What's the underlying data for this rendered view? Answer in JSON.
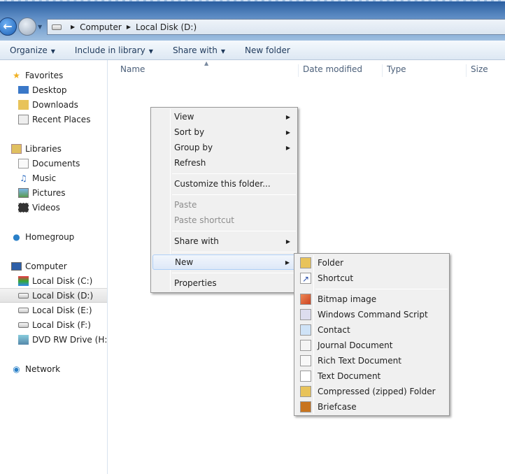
{
  "address": {
    "crumbs": [
      "Computer",
      "Local Disk (D:)"
    ]
  },
  "toolbar": {
    "organize": "Organize",
    "include": "Include in library",
    "share": "Share with",
    "new_folder": "New folder"
  },
  "sidebar": {
    "favorites": "Favorites",
    "fav_items": [
      "Desktop",
      "Downloads",
      "Recent Places"
    ],
    "libraries": "Libraries",
    "lib_items": [
      "Documents",
      "Music",
      "Pictures",
      "Videos"
    ],
    "homegroup": "Homegroup",
    "computer": "Computer",
    "comp_items": [
      "Local Disk (C:)",
      "Local Disk (D:)",
      "Local Disk (E:)",
      "Local Disk (F:)",
      "DVD RW Drive (H:) G"
    ],
    "network": "Network",
    "selected": "Local Disk (D:)"
  },
  "columns": [
    "Name",
    "Date modified",
    "Type",
    "Size"
  ],
  "context_menu": {
    "items": [
      {
        "label": "View",
        "submenu": true
      },
      {
        "label": "Sort by",
        "submenu": true
      },
      {
        "label": "Group by",
        "submenu": true
      },
      {
        "label": "Refresh"
      },
      {
        "label": "Customize this folder..."
      },
      {
        "label": "Paste",
        "disabled": true
      },
      {
        "label": "Paste shortcut",
        "disabled": true
      },
      {
        "label": "Share with",
        "submenu": true
      },
      {
        "label": "New",
        "submenu": true,
        "highlighted": true
      },
      {
        "label": "Properties"
      }
    ]
  },
  "new_submenu": {
    "items": [
      {
        "label": "Folder",
        "icon": "folder-icon"
      },
      {
        "label": "Shortcut",
        "icon": "shortcut-icon"
      },
      {
        "label": "Bitmap image",
        "icon": "bitmap-icon"
      },
      {
        "label": "Windows Command Script",
        "icon": "script-icon"
      },
      {
        "label": "Contact",
        "icon": "contact-icon"
      },
      {
        "label": "Journal Document",
        "icon": "journal-icon"
      },
      {
        "label": "Rich Text Document",
        "icon": "rtf-icon"
      },
      {
        "label": "Text Document",
        "icon": "text-document-icon"
      },
      {
        "label": "Compressed (zipped) Folder",
        "icon": "zip-folder-icon"
      },
      {
        "label": "Briefcase",
        "icon": "briefcase-icon"
      }
    ]
  }
}
